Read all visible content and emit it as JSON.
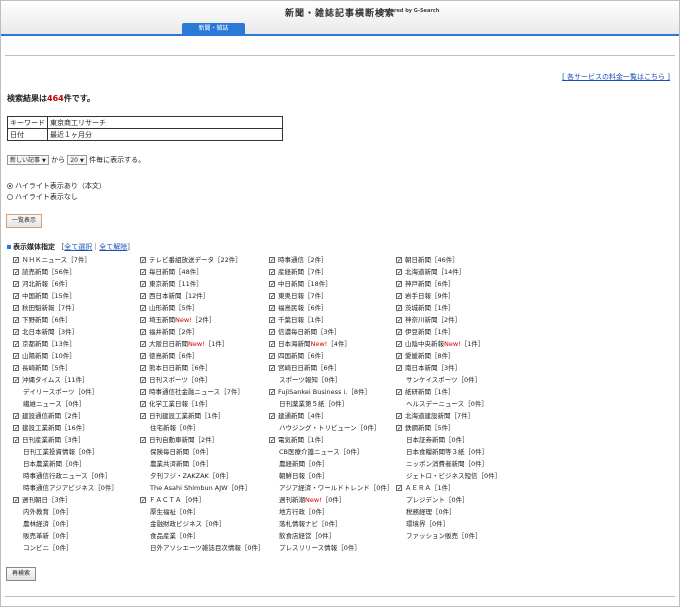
{
  "header": {
    "title": "新聞・雑誌記事横断検索",
    "powered": "powered by G-Search",
    "tab": "新聞・雑誌"
  },
  "price_link": "[ 各サービスの料金一覧はこちら ]",
  "result": {
    "prefix": "検索結果は",
    "count": "464",
    "suffix": "件です。"
  },
  "conditions": [
    {
      "key": "キーワード",
      "value": "東京商工リサーチ"
    },
    {
      "key": "日付",
      "value": "最近１ヶ月分"
    }
  ],
  "display": {
    "order": "新しい記事",
    "from": "から",
    "per_page": "20",
    "suffix": "件毎に表示する。"
  },
  "highlight": [
    {
      "label": "ハイライト表示あり（本文）",
      "checked": true
    },
    {
      "label": "ハイライト表示なし",
      "checked": false
    }
  ],
  "buttons": {
    "list": "一覧表示",
    "search": "再検索"
  },
  "media": {
    "title": "表示媒体指定",
    "select_all": "全て選択",
    "clear_all": "全て解除",
    "columns": [
      [
        {
          "name": "ＮＨＫニュース",
          "count": "［7件］",
          "checked": true
        },
        {
          "name": "読売新聞",
          "count": "［56件］",
          "checked": true
        },
        {
          "name": "河北新報",
          "count": "［6件］",
          "checked": true
        },
        {
          "name": "中国新聞",
          "count": "［15件］",
          "checked": true
        },
        {
          "name": "秋田魁新報",
          "count": "［7件］",
          "checked": true
        },
        {
          "name": "下野新聞",
          "count": "［6件］",
          "checked": true
        },
        {
          "name": "北日本新聞",
          "count": "［3件］",
          "checked": true
        },
        {
          "name": "京都新聞",
          "count": "［13件］",
          "checked": true
        },
        {
          "name": "山陽新聞",
          "count": "［10件］",
          "checked": true
        },
        {
          "name": "長崎新聞",
          "count": "［5件］",
          "checked": true
        },
        {
          "name": "沖縄タイムス",
          "count": "［11件］",
          "checked": true
        },
        {
          "name": "デイリースポーツ",
          "count": "［0件］",
          "checked": null
        },
        {
          "name": "繊維ニュース",
          "count": "［0件］",
          "checked": null
        },
        {
          "name": "建設通信新聞",
          "count": "［2件］",
          "checked": true
        },
        {
          "name": "建設工業新聞",
          "count": "［16件］",
          "checked": true
        },
        {
          "name": "日刊産業新聞",
          "count": "［3件］",
          "checked": true
        },
        {
          "name": "日刊工業投資情報",
          "count": "［0件］",
          "checked": null
        },
        {
          "name": "日本農業新聞",
          "count": "［0件］",
          "checked": null
        },
        {
          "name": "時事通信行政ニュース",
          "count": "［0件］",
          "checked": null
        },
        {
          "name": "時事通信アジアビジネス",
          "count": "［0件］",
          "checked": null
        },
        {
          "name": "週刊朝日",
          "count": "［3件］",
          "checked": true
        },
        {
          "name": "内外教育",
          "count": "［0件］",
          "checked": null
        },
        {
          "name": "農林経済",
          "count": "［0件］",
          "checked": null
        },
        {
          "name": "販売革新",
          "count": "［0件］",
          "checked": null
        },
        {
          "name": "コンビニ",
          "count": "［0件］",
          "checked": null
        }
      ],
      [
        {
          "name": "テレビ番組放送データ",
          "count": "［22件］",
          "checked": true
        },
        {
          "name": "毎日新聞",
          "count": "［48件］",
          "checked": true
        },
        {
          "name": "東京新聞",
          "count": "［11件］",
          "checked": true
        },
        {
          "name": "西日本新聞",
          "count": "［12件］",
          "checked": true
        },
        {
          "name": "山形新聞",
          "count": "［5件］",
          "checked": true
        },
        {
          "name": "埼玉新聞",
          "count": "［2件］",
          "checked": true,
          "new": "New!"
        },
        {
          "name": "福井新聞",
          "count": "［2件］",
          "checked": true
        },
        {
          "name": "大阪日日新聞",
          "count": "［1件］",
          "checked": true,
          "new": "New!"
        },
        {
          "name": "徳島新聞",
          "count": "［6件］",
          "checked": true
        },
        {
          "name": "熊本日日新聞",
          "count": "［6件］",
          "checked": true
        },
        {
          "name": "日刊スポーツ",
          "count": "［0件］",
          "checked": true
        },
        {
          "name": "時事通信社金融ニュース",
          "count": "［7件］",
          "checked": true
        },
        {
          "name": "化学工業日報",
          "count": "［1件］",
          "checked": true
        },
        {
          "name": "日刊建設工業新聞",
          "count": "［1件］",
          "checked": true
        },
        {
          "name": "住宅新報",
          "count": "［0件］",
          "checked": null
        },
        {
          "name": "日刊自動車新聞",
          "count": "［2件］",
          "checked": true
        },
        {
          "name": "保険毎日新聞",
          "count": "［0件］",
          "checked": null
        },
        {
          "name": "農業共済新聞",
          "count": "［0件］",
          "checked": null
        },
        {
          "name": "夕刊フジ・ZAKZAK",
          "count": "［0件］",
          "checked": null
        },
        {
          "name": "The Asahi Shimbun AJW",
          "count": "［0件］",
          "checked": null
        },
        {
          "name": "ＦＡＣＴＡ",
          "count": "［0件］",
          "checked": true
        },
        {
          "name": "厚生福祉",
          "count": "［0件］",
          "checked": null
        },
        {
          "name": "金融財政ビジネス",
          "count": "［0件］",
          "checked": null
        },
        {
          "name": "食品産業",
          "count": "［0件］",
          "checked": null
        },
        {
          "name": "日外アソシエーツ雑誌目次情報",
          "count": "［0件］",
          "checked": null
        }
      ],
      [
        {
          "name": "時事通信",
          "count": "［2件］",
          "checked": true
        },
        {
          "name": "産経新聞",
          "count": "［7件］",
          "checked": true
        },
        {
          "name": "中日新聞",
          "count": "［18件］",
          "checked": true
        },
        {
          "name": "東奥日報",
          "count": "［7件］",
          "checked": true
        },
        {
          "name": "福島民報",
          "count": "［6件］",
          "checked": true
        },
        {
          "name": "千葉日報",
          "count": "［1件］",
          "checked": true
        },
        {
          "name": "信濃毎日新聞",
          "count": "［3件］",
          "checked": true
        },
        {
          "name": "日本海新聞",
          "count": "［4件］",
          "checked": true,
          "new": "New!"
        },
        {
          "name": "四国新聞",
          "count": "［6件］",
          "checked": true
        },
        {
          "name": "宮崎日日新聞",
          "count": "［6件］",
          "checked": true
        },
        {
          "name": "スポーツ報知",
          "count": "［0件］",
          "checked": null
        },
        {
          "name": "FujiSankei Business i.",
          "count": "［8件］",
          "checked": true
        },
        {
          "name": "日刊薬業第５紙",
          "count": "［0件］",
          "checked": null
        },
        {
          "name": "建通新聞",
          "count": "［4件］",
          "checked": true
        },
        {
          "name": "ハウジング・トリビューン",
          "count": "［0件］",
          "checked": null
        },
        {
          "name": "電気新聞",
          "count": "［1件］",
          "checked": true
        },
        {
          "name": "CB医療介護ニュース",
          "count": "［0件］",
          "checked": null
        },
        {
          "name": "農経新聞",
          "count": "［0件］",
          "checked": null
        },
        {
          "name": "朝鮮日報",
          "count": "［0件］",
          "checked": null
        },
        {
          "name": "アジア経済・ワールドトレンド",
          "count": "［0件］",
          "checked": null
        },
        {
          "name": "週刊新潮",
          "count": "［0件］",
          "checked": null,
          "new": "New!"
        },
        {
          "name": "地方行政",
          "count": "［0件］",
          "checked": null
        },
        {
          "name": "落札情報ナビ",
          "count": "［0件］",
          "checked": null
        },
        {
          "name": "飲食店経営",
          "count": "［0件］",
          "checked": null
        },
        {
          "name": "プレスリリース情報",
          "count": "［0件］",
          "checked": null
        }
      ],
      [
        {
          "name": "朝日新聞",
          "count": "［46件］",
          "checked": true
        },
        {
          "name": "北海道新聞",
          "count": "［14件］",
          "checked": true
        },
        {
          "name": "神戸新聞",
          "count": "［6件］",
          "checked": true
        },
        {
          "name": "岩手日報",
          "count": "［9件］",
          "checked": true
        },
        {
          "name": "茨城新聞",
          "count": "［1件］",
          "checked": true
        },
        {
          "name": "神奈川新聞",
          "count": "［2件］",
          "checked": true
        },
        {
          "name": "伊豆新聞",
          "count": "［1件］",
          "checked": true
        },
        {
          "name": "山陰中央新報",
          "count": "［1件］",
          "checked": true,
          "new": "New!"
        },
        {
          "name": "愛媛新聞",
          "count": "［8件］",
          "checked": true
        },
        {
          "name": "南日本新聞",
          "count": "［3件］",
          "checked": true
        },
        {
          "name": "サンケイスポーツ",
          "count": "［0件］",
          "checked": null
        },
        {
          "name": "紙研新聞",
          "count": "［1件］",
          "checked": true
        },
        {
          "name": "ヘルスデーニュース",
          "count": "［0件］",
          "checked": null
        },
        {
          "name": "北海道建設新聞",
          "count": "［7件］",
          "checked": true
        },
        {
          "name": "鉄鋼新聞",
          "count": "［5件］",
          "checked": true
        },
        {
          "name": "日本証券新聞",
          "count": "［0件］",
          "checked": null
        },
        {
          "name": "日本食糧新聞等３紙",
          "count": "［0件］",
          "checked": null
        },
        {
          "name": "ニッポン消費者新聞",
          "count": "［0件］",
          "checked": null
        },
        {
          "name": "ジェトロ・ビジネス短信",
          "count": "［0件］",
          "checked": null
        },
        {
          "name": "ＡＥＲＡ",
          "count": "［1件］",
          "checked": true
        },
        {
          "name": "プレジデント",
          "count": "［0件］",
          "checked": null
        },
        {
          "name": "税務経理",
          "count": "［0件］",
          "checked": null
        },
        {
          "name": "環境界",
          "count": "［0件］",
          "checked": null
        },
        {
          "name": "ファッション販売",
          "count": "［0件］",
          "checked": null
        }
      ]
    ]
  }
}
